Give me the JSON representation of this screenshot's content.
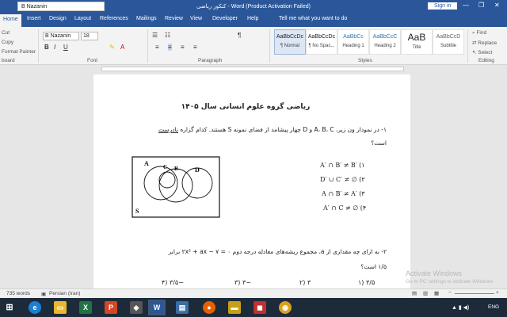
{
  "titlebar": {
    "user_field": "B Nazanin",
    "title": "کنکور ریاضی - Word (Product Activation Failed)",
    "sign_in": "Sign in",
    "minimize": "—",
    "restore": "❐",
    "close": "✕"
  },
  "tabs": [
    "Home",
    "Insert",
    "Design",
    "Layout",
    "References",
    "Mailings",
    "Review",
    "View",
    "Developer",
    "Help"
  ],
  "tell_me": "Tell me what you want to do",
  "ribbon": {
    "clipboard": {
      "cut": "Cut",
      "copy": "Copy",
      "format_painter": "Format Painter",
      "label": "board"
    },
    "font": {
      "name": "B Nazanin",
      "size": "18",
      "label": "Font",
      "bold": "B",
      "italic": "I",
      "underline": "U"
    },
    "paragraph": {
      "label": "Paragraph"
    },
    "styles": {
      "label": "Styles",
      "items": [
        {
          "sample": "AaBbCcDc",
          "name": "¶ Normal"
        },
        {
          "sample": "AaBbCcDc",
          "name": "¶ No Spac..."
        },
        {
          "sample": "AaBbCc",
          "name": "Heading 1"
        },
        {
          "sample": "AaBbCcC",
          "name": "Heading 2"
        },
        {
          "sample": "AaB",
          "name": "Title"
        },
        {
          "sample": "AaBbCcD",
          "name": "Subtitle"
        }
      ]
    },
    "editing": {
      "label": "Editing",
      "find": "Find",
      "replace": "Replace",
      "select": "Select"
    }
  },
  "document": {
    "title": "ریاضی گروه علوم انسانی سال ۱۴۰۵",
    "q1_text": "۱- در نمودار ون زیر، A، B، C و D چهار پیشامد از فضای نمونه S هستند. کدام گزاره",
    "q1_underline": "نادرست",
    "q1_tail": "است؟",
    "venn_labels": {
      "a": "A",
      "b": "B",
      "c": "C",
      "d": "D",
      "s": "S"
    },
    "q1_options": [
      "A′ ∩ B′ ≠ B′ (۱",
      "D′ ∪ C′ ≠ ∅ (۲",
      "A ∩ B′ ≠ A′ (۳",
      "A′ ∩ C ≠ ∅ (۴"
    ],
    "q2_text": "۲- به ازای چه مقداری از a، مجموع ریشه‌های معادله درجه دوم  ۲x² + ax − ۷ = ۰  برابر",
    "q2_tail": "۱/۵ است؟",
    "q2_options": [
      "۳/۵ (۱",
      "۳ (۲",
      "−۳ (۳",
      "−۳/۵ (۴"
    ]
  },
  "statusbar": {
    "words": "735 words",
    "language": "Persian (Iran)"
  },
  "watermark": {
    "line1": "Activate Windows",
    "line2": "Go to PC settings to activate Windows"
  },
  "taskbar": {
    "lang": "ENG"
  },
  "colors": {
    "accent": "#2b579a",
    "taskbar": "#1c2a3a"
  }
}
